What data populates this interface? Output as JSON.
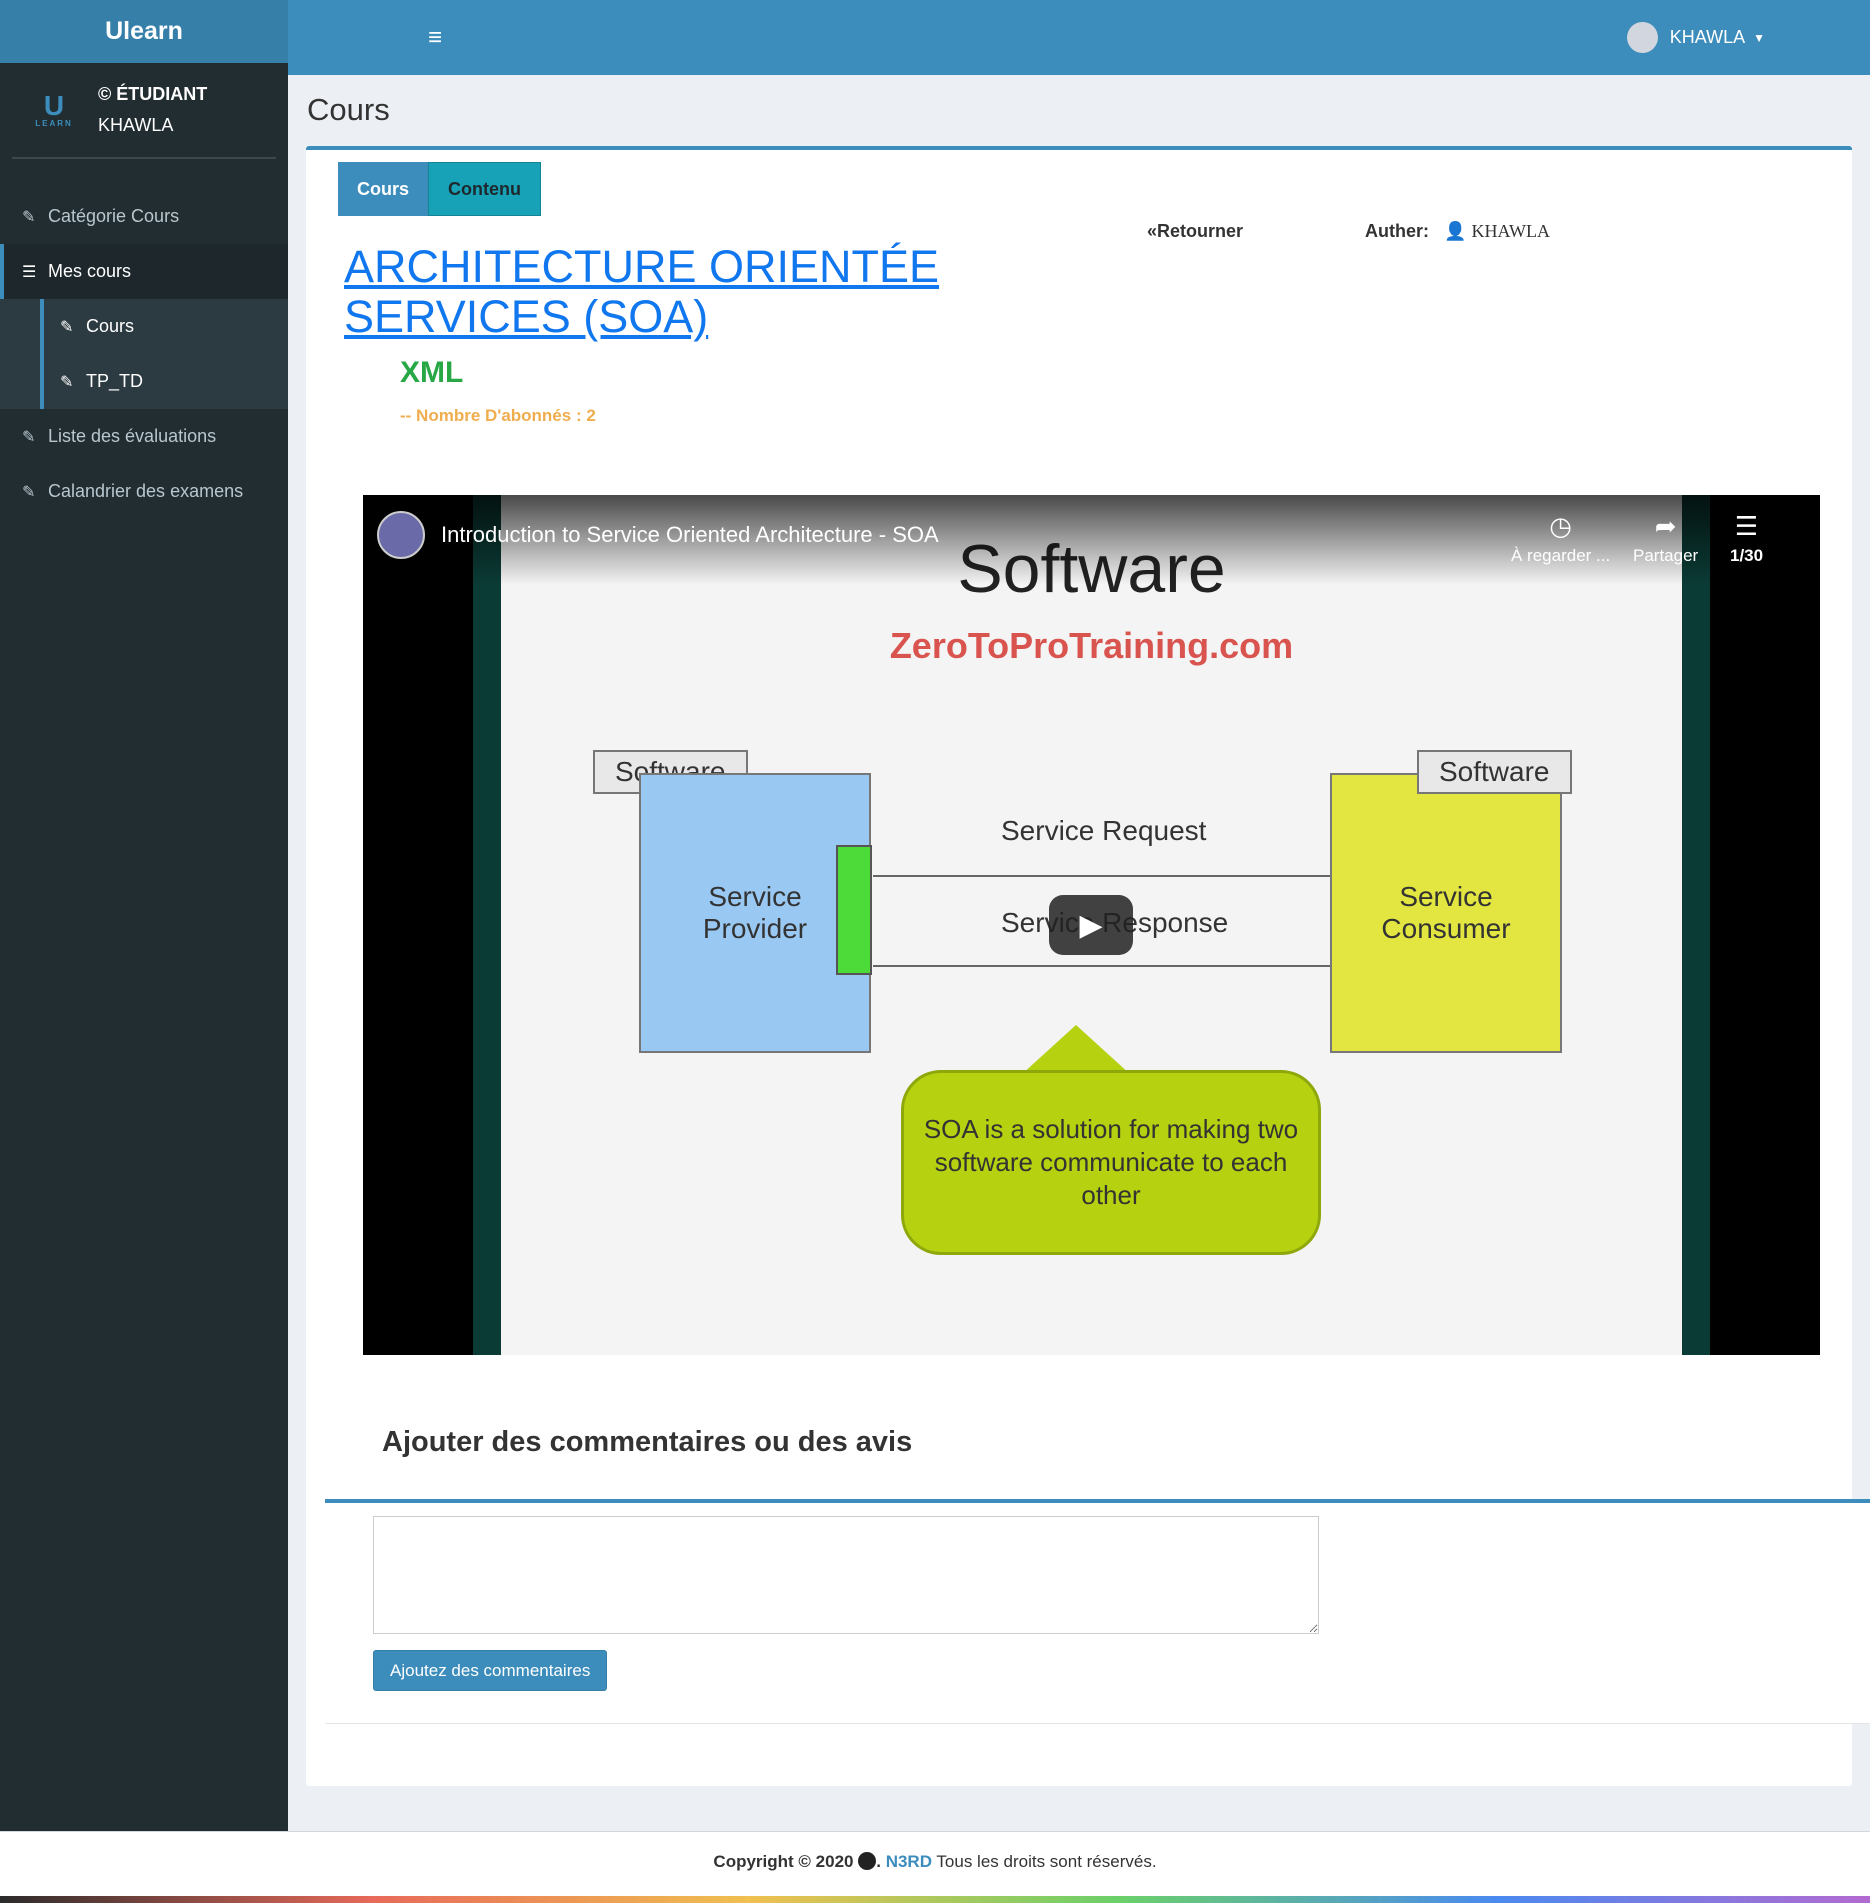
{
  "app": {
    "name": "Ulearn"
  },
  "sidebar": {
    "logo_letter": "U",
    "logo_text": "LEARN",
    "role": "© ÉTUDIANT",
    "username": "KHAWLA",
    "items": [
      {
        "label": "Catégorie Cours",
        "icon": "edit-icon"
      },
      {
        "label": "Mes cours",
        "icon": "list-icon"
      },
      {
        "label": "Cours",
        "icon": "edit-icon"
      },
      {
        "label": "TP_TD",
        "icon": "edit-icon"
      },
      {
        "label": "Liste des évaluations",
        "icon": "edit-icon"
      },
      {
        "label": "Calandrier des examens",
        "icon": "edit-icon"
      }
    ]
  },
  "header": {
    "username": "KHAWLA"
  },
  "page": {
    "title": "Cours"
  },
  "course": {
    "tabs": [
      "Cours",
      "Contenu"
    ],
    "back_label": "Retourner",
    "author_label": "Auther:",
    "author_name": "KHAWLA",
    "title": "ARCHITECTURE ORIENTÉE SERVICES (SOA)",
    "subtitle": "XML",
    "subscribers": "-- Nombre D'abonnés : 2"
  },
  "video": {
    "title": "Introduction to Service Oriented Architecture - SOA",
    "watch_later": "À regarder ...",
    "share": "Partager",
    "playlist_counter": "1/30",
    "slide": {
      "title": "Software",
      "url": "ZeroToProTraining.com",
      "left_label": "Software",
      "right_label": "Software",
      "provider": "Service Provider",
      "consumer": "Service Consumer",
      "request": "Service Request",
      "response": "Service Response",
      "bubble": "SOA is a solution for making two software communicate to each other"
    }
  },
  "comments": {
    "title": "Ajouter des commentaires ou des avis",
    "button": "Ajoutez des commentaires"
  },
  "footer": {
    "copyright": "Copyright © 2020",
    "brand": "N3RD",
    "rights": "Tous les droits sont réservés."
  },
  "colors": {
    "primary": "#3c8dbc",
    "sidebar": "#222d32",
    "accent_green": "#28a745",
    "accent_orange": "#f0ad4e"
  }
}
